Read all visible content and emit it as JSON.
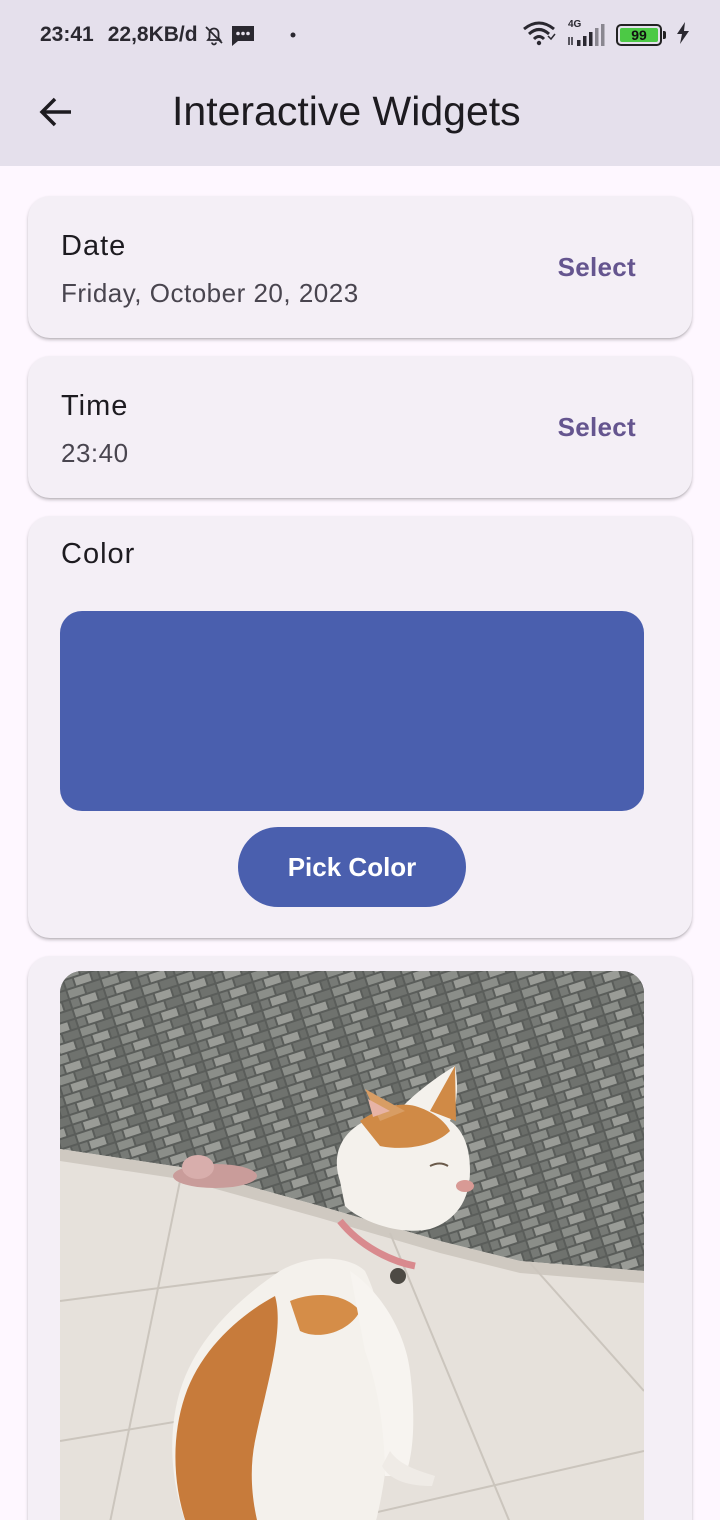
{
  "status_bar": {
    "time": "23:41",
    "net_speed": "22,8KB/d",
    "signal_label": "4G",
    "battery_level": "99",
    "icons": [
      "bell-muted-icon",
      "message-icon",
      "dot-icon",
      "wifi-icon",
      "signal-icon",
      "battery-icon",
      "charging-icon"
    ]
  },
  "app_bar": {
    "title": "Interactive Widgets",
    "back_icon": "arrow-back-icon"
  },
  "date_card": {
    "label": "Date",
    "value": "Friday, October 20, 2023",
    "action": "Select"
  },
  "time_card": {
    "label": "Time",
    "value": "23:40",
    "action": "Select"
  },
  "color_card": {
    "label": "Color",
    "selected_color": "#4a5fae",
    "button": "Pick Color"
  },
  "photo_card": {
    "image": "cat-photo"
  },
  "colors": {
    "accent": "#65558f",
    "background": "#fef7ff",
    "app_bar": "#e5e0ec",
    "card": "#f4eff6",
    "battery": "#4cc945"
  }
}
